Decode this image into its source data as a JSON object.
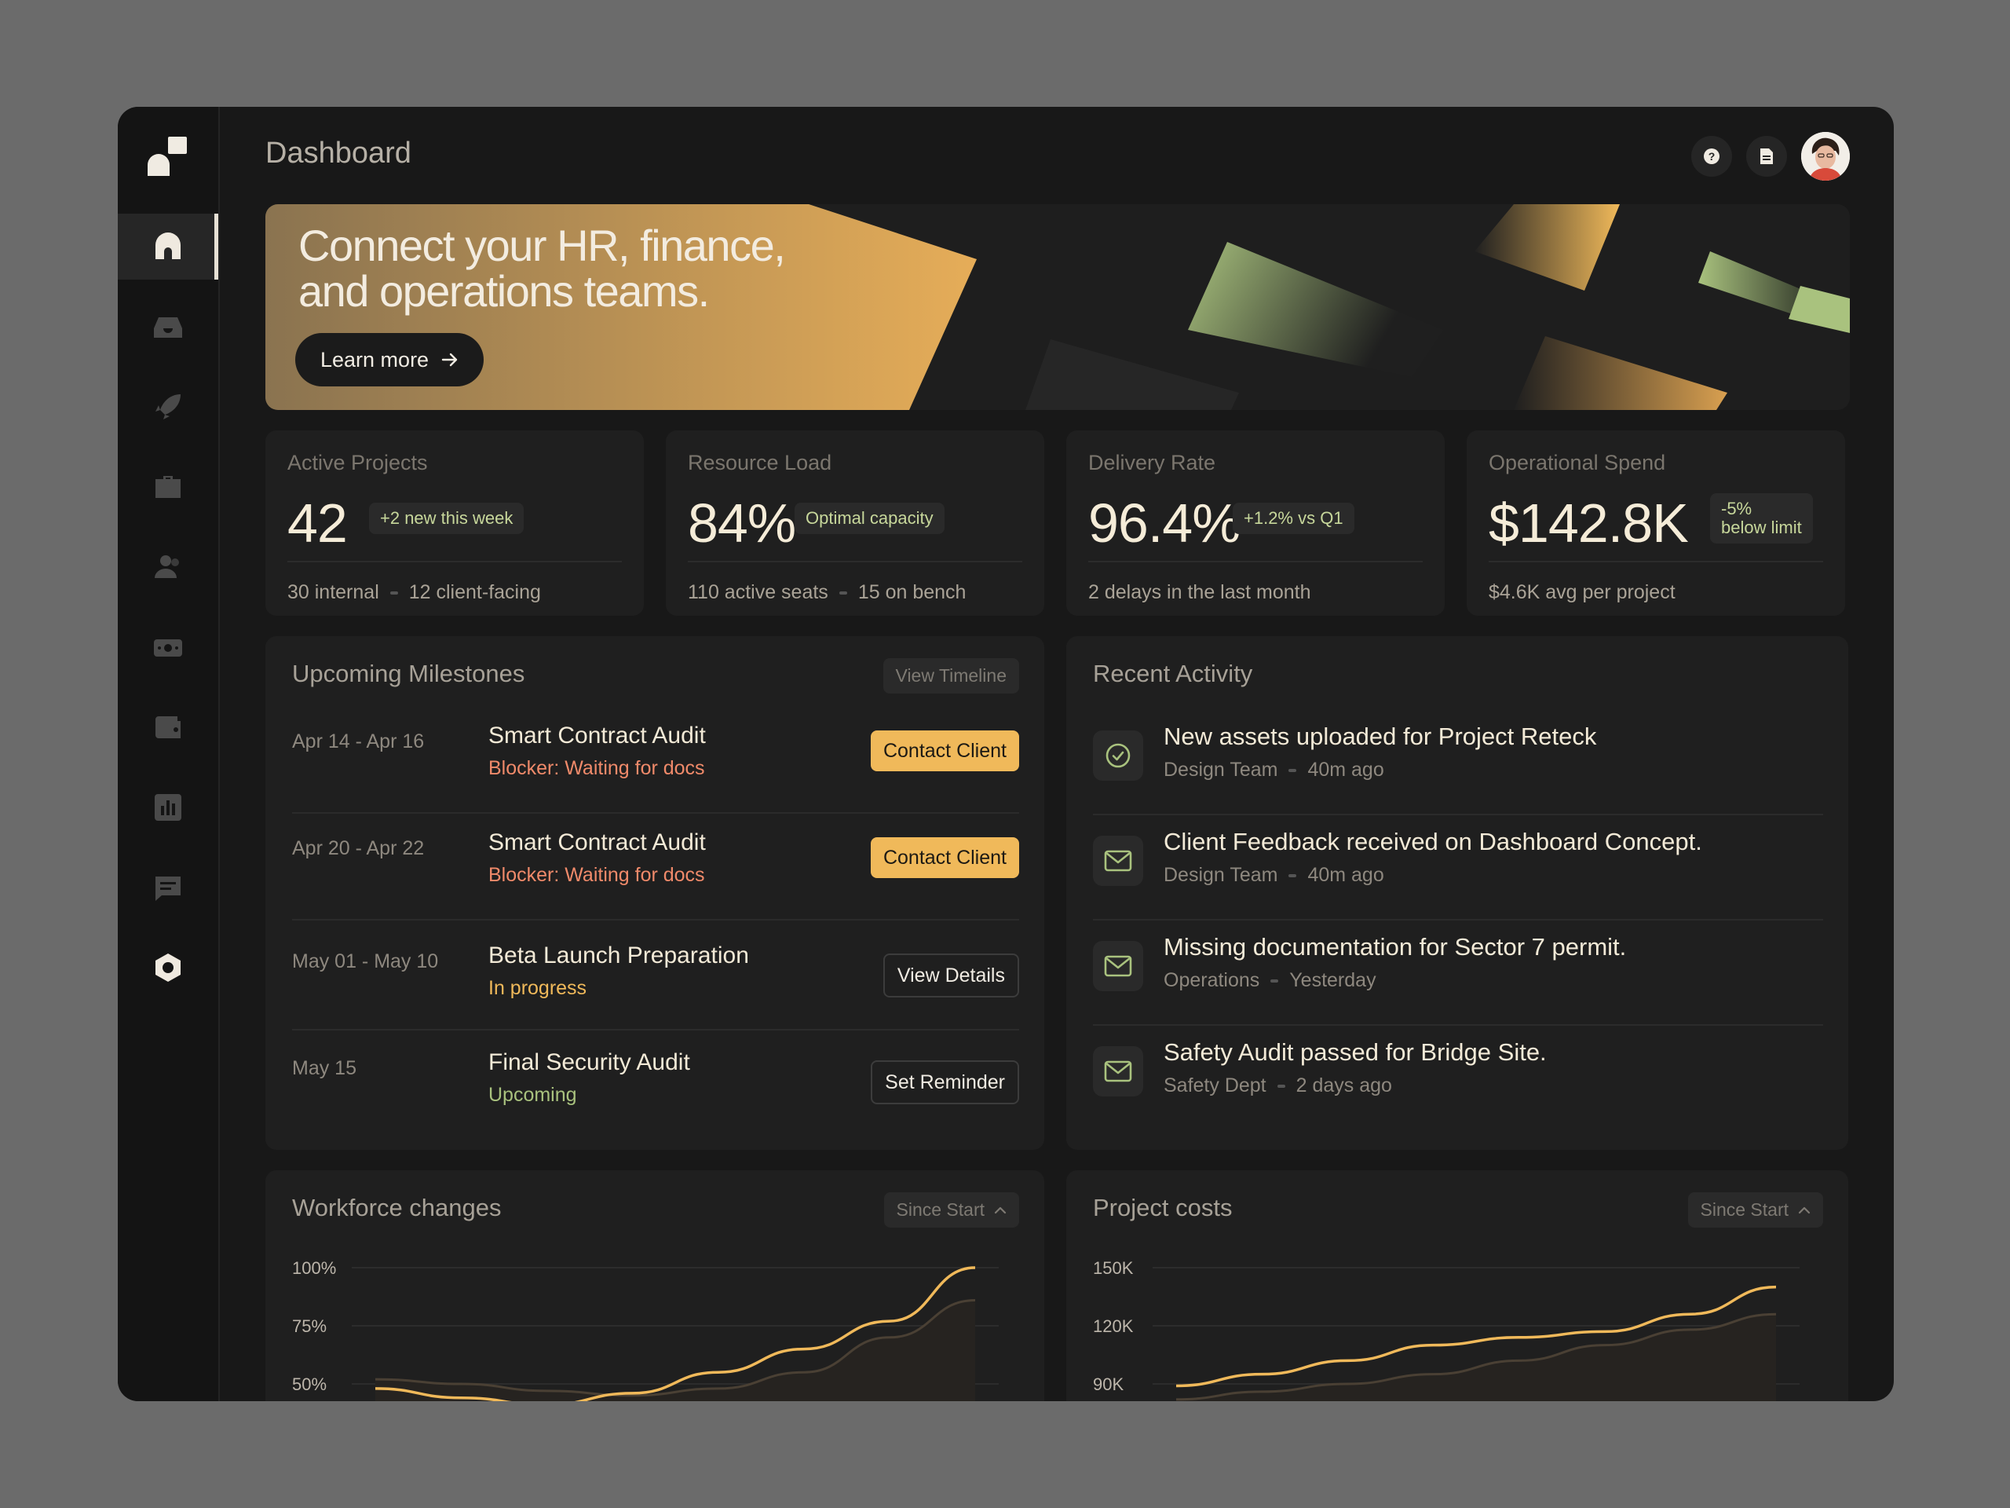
{
  "page_title": "Dashboard",
  "banner": {
    "title_line1": "Connect your HR, finance,",
    "title_line2": "and operations teams.",
    "button_label": "Learn more"
  },
  "stats": [
    {
      "label": "Active Projects",
      "value": "42",
      "badge": "+2 new this week",
      "foot_a": "30 internal",
      "foot_b": "12 client-facing"
    },
    {
      "label": "Resource Load",
      "value": "84%",
      "badge": "Optimal capacity",
      "foot_a": "110 active seats",
      "foot_b": "15 on bench"
    },
    {
      "label": "Delivery Rate",
      "value": "96.4%",
      "badge": "+1.2% vs Q1",
      "foot_a": "2 delays in the last month",
      "foot_b": ""
    },
    {
      "label": "Operational Spend",
      "value": "$142.8K",
      "badge_line1": "-5%",
      "badge_line2": "below limit",
      "foot_a": "$4.6K avg per project",
      "foot_b": ""
    }
  ],
  "milestones": {
    "title": "Upcoming Milestones",
    "link": "View Timeline",
    "items": [
      {
        "date": "Apr 14 - Apr 16",
        "name": "Smart Contract Audit",
        "status": "Blocker: Waiting for docs",
        "action": "Contact Client"
      },
      {
        "date": "Apr 20 - Apr 22",
        "name": "Smart Contract Audit",
        "status": "Blocker: Waiting for docs",
        "action": "Contact Client"
      },
      {
        "date": "May 01 - May 10",
        "name": "Beta Launch Preparation",
        "status": "In progress",
        "action": "View Details"
      },
      {
        "date": "May 15",
        "name": "Final Security Audit",
        "status": "Upcoming",
        "action": "Set Reminder"
      }
    ]
  },
  "activity": {
    "title": "Recent Activity",
    "items": [
      {
        "icon": "check-circle-icon",
        "title": "New assets uploaded for Project Reteck",
        "who": "Design Team",
        "when": "40m ago"
      },
      {
        "icon": "mail-icon",
        "title": "Client Feedback received on Dashboard Concept.",
        "who": "Design Team",
        "when": "40m ago"
      },
      {
        "icon": "mail-icon",
        "title": "Missing documentation for Sector 7 permit.",
        "who": "Operations",
        "when": "Yesterday"
      },
      {
        "icon": "mail-icon",
        "title": "Safety Audit passed for Bridge Site.",
        "who": "Safety Dept",
        "when": "2 days ago"
      }
    ]
  },
  "workforce": {
    "title": "Workforce changes",
    "range": "Since Start"
  },
  "costs": {
    "title": "Project costs",
    "range": "Since Start"
  },
  "chart_data": [
    {
      "type": "line",
      "title": "Workforce changes",
      "y_ticks": [
        "100%",
        "75%",
        "50%"
      ],
      "ylim": [
        50,
        100
      ],
      "series": [
        {
          "values": [
            48,
            44,
            41,
            46,
            55,
            65,
            77,
            100
          ]
        },
        {
          "values": [
            52,
            50,
            47,
            45,
            48,
            55,
            70,
            86
          ]
        }
      ]
    },
    {
      "type": "line",
      "title": "Project costs",
      "y_ticks": [
        "150K",
        "120K",
        "90K"
      ],
      "ylim": [
        90,
        150
      ],
      "series": [
        {
          "values": [
            89,
            95,
            102,
            110,
            114,
            117,
            126,
            140
          ]
        },
        {
          "values": [
            82,
            86,
            90,
            95,
            102,
            110,
            118,
            126
          ]
        }
      ]
    }
  ],
  "colors": {
    "accent": "#f0b95a",
    "green": "#a9c27e",
    "danger": "#f08a6a",
    "progress": "#f0b95a"
  }
}
